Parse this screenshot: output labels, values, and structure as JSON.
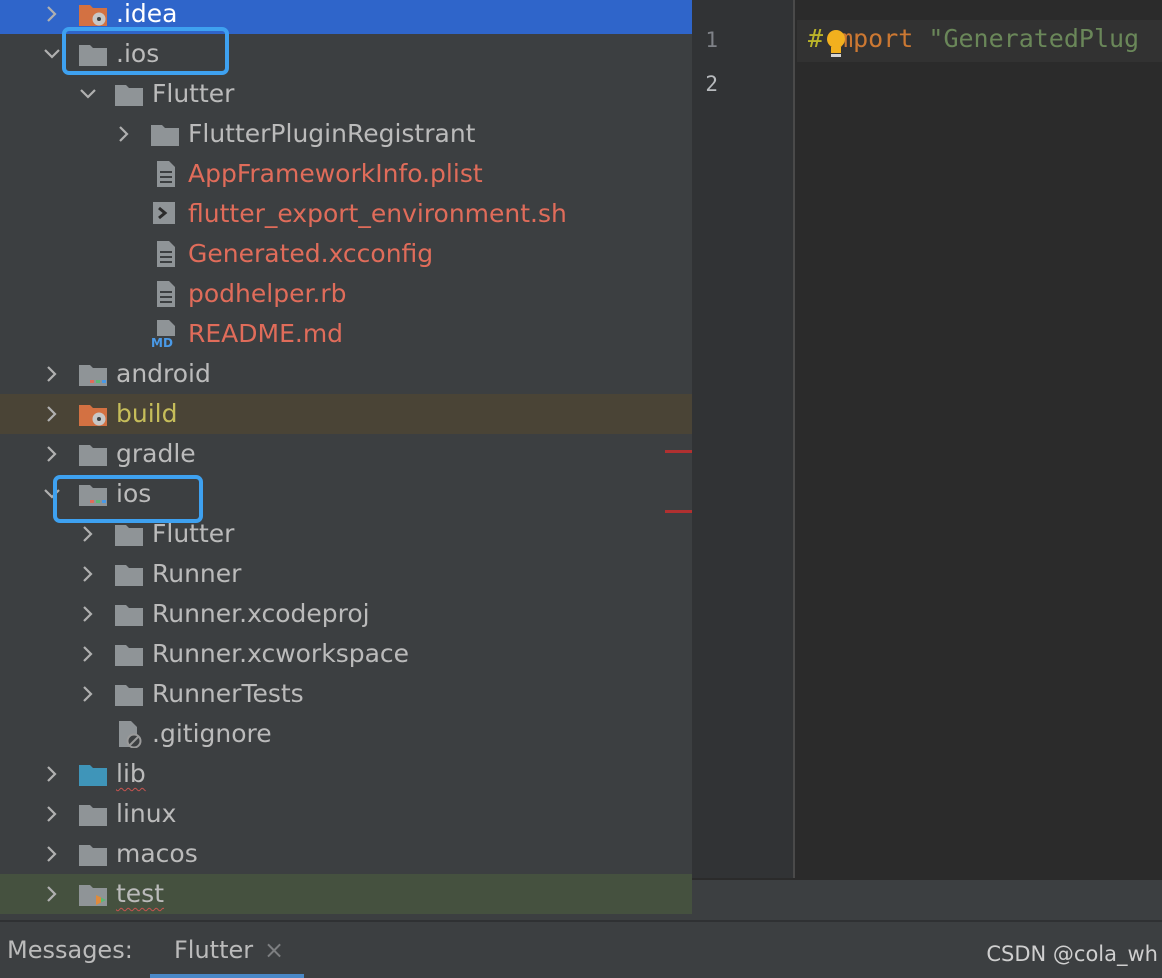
{
  "project_tree": {
    "rows": [
      {
        "label": ".idea",
        "state": "collapsed",
        "icon": "folder-excluded-icon",
        "color": "normal",
        "selected": true
      },
      {
        "label": ".ios",
        "state": "expanded",
        "icon": "folder-icon",
        "color": "normal"
      },
      {
        "label": "Flutter",
        "state": "expanded",
        "icon": "folder-icon",
        "color": "normal"
      },
      {
        "label": "FlutterPluginRegistrant",
        "state": "collapsed",
        "icon": "folder-icon",
        "color": "normal"
      },
      {
        "label": "AppFrameworkInfo.plist",
        "state": "leaf",
        "icon": "file-icon",
        "color": "untracked"
      },
      {
        "label": "flutter_export_environment.sh",
        "state": "leaf",
        "icon": "shell-script-icon",
        "color": "untracked"
      },
      {
        "label": "Generated.xcconfig",
        "state": "leaf",
        "icon": "file-icon",
        "color": "untracked"
      },
      {
        "label": "podhelper.rb",
        "state": "leaf",
        "icon": "file-icon",
        "color": "untracked"
      },
      {
        "label": "README.md",
        "state": "leaf",
        "icon": "markdown-file-icon",
        "color": "untracked"
      },
      {
        "label": "android",
        "state": "collapsed",
        "icon": "module-folder-icon",
        "color": "normal"
      },
      {
        "label": "build",
        "state": "collapsed",
        "icon": "folder-excluded-icon",
        "color": "excluded"
      },
      {
        "label": "gradle",
        "state": "collapsed",
        "icon": "folder-icon",
        "color": "normal"
      },
      {
        "label": "ios",
        "state": "expanded",
        "icon": "module-folder-icon",
        "color": "normal"
      },
      {
        "label": "Flutter",
        "state": "collapsed",
        "icon": "folder-icon",
        "color": "normal"
      },
      {
        "label": "Runner",
        "state": "collapsed",
        "icon": "folder-icon",
        "color": "normal"
      },
      {
        "label": "Runner.xcodeproj",
        "state": "collapsed",
        "icon": "folder-icon",
        "color": "normal"
      },
      {
        "label": "Runner.xcworkspace",
        "state": "collapsed",
        "icon": "folder-icon",
        "color": "normal"
      },
      {
        "label": "RunnerTests",
        "state": "collapsed",
        "icon": "folder-icon",
        "color": "normal"
      },
      {
        "label": ".gitignore",
        "state": "leaf",
        "icon": "ignored-file-icon",
        "color": "normal"
      },
      {
        "label": "lib",
        "state": "collapsed",
        "icon": "source-folder-icon",
        "color": "normal",
        "squiggle": true
      },
      {
        "label": "linux",
        "state": "collapsed",
        "icon": "folder-icon",
        "color": "normal"
      },
      {
        "label": "macos",
        "state": "collapsed",
        "icon": "folder-icon",
        "color": "normal"
      },
      {
        "label": "test",
        "state": "collapsed",
        "icon": "test-folder-icon",
        "color": "test",
        "squiggle": true
      }
    ]
  },
  "editor": {
    "line_numbers": [
      "1",
      "2"
    ],
    "code_line_1": {
      "hash": "#",
      "keyword_rest": "mport",
      "string": "\"GeneratedPlug"
    },
    "gutter_hint": "lightbulb-icon"
  },
  "bottom_bar": {
    "messages_label": "Messages:",
    "active_tab": "Flutter",
    "close_glyph": "×"
  },
  "watermark": "CSDN @cola_wh",
  "colors": {
    "selection": "#2f65ca",
    "untracked_file": "#e06c5a",
    "excluded_row": "#4a4436",
    "test_row": "#45513f",
    "highlight_box": "#3ea1f0",
    "code_keyword": "#cc7832",
    "code_string": "#6a8759",
    "code_hash": "#bbb529"
  }
}
